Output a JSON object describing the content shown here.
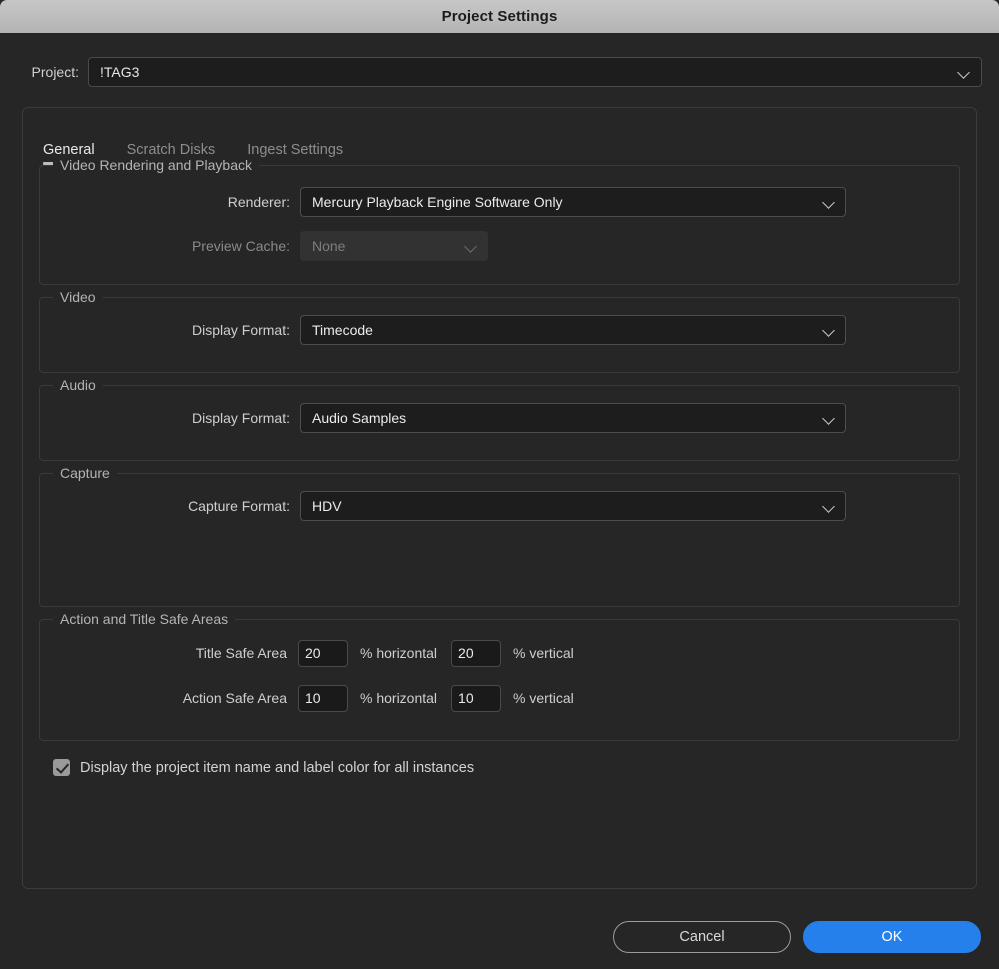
{
  "window": {
    "title": "Project Settings"
  },
  "project": {
    "label": "Project:",
    "value": "!TAG3",
    "chevron_icon": "chevron-down-icon"
  },
  "tabs": [
    {
      "label": "General",
      "active": true
    },
    {
      "label": "Scratch Disks",
      "active": false
    },
    {
      "label": "Ingest Settings",
      "active": false
    }
  ],
  "sections": {
    "video_rendering": {
      "legend": "Video Rendering and Playback",
      "renderer": {
        "label": "Renderer:",
        "value": "Mercury Playback Engine Software Only",
        "enabled": true
      },
      "preview_cache": {
        "label": "Preview Cache:",
        "value": "None",
        "enabled": false
      }
    },
    "video": {
      "legend": "Video",
      "display_format": {
        "label": "Display Format:",
        "value": "Timecode"
      }
    },
    "audio": {
      "legend": "Audio",
      "display_format": {
        "label": "Display Format:",
        "value": "Audio Samples"
      }
    },
    "capture": {
      "legend": "Capture",
      "capture_format": {
        "label": "Capture Format:",
        "value": "HDV"
      }
    },
    "safe_areas": {
      "legend": "Action and Title Safe Areas",
      "title_safe": {
        "label": "Title Safe Area",
        "horizontal": "20",
        "vertical": "20"
      },
      "action_safe": {
        "label": "Action Safe Area",
        "horizontal": "10",
        "vertical": "10"
      },
      "unit_horizontal": "% horizontal",
      "unit_vertical": "% vertical"
    }
  },
  "display_option": {
    "label": "Display the project item name and label color for all instances",
    "checked": true
  },
  "footer": {
    "cancel_label": "Cancel",
    "ok_label": "OK"
  },
  "colors": {
    "accent_blue": "#2680eb",
    "window_bg": "#262626",
    "titlebar": "#bdbdbd",
    "field_bg": "#1d1d1d",
    "disabled_bg": "#323232"
  }
}
